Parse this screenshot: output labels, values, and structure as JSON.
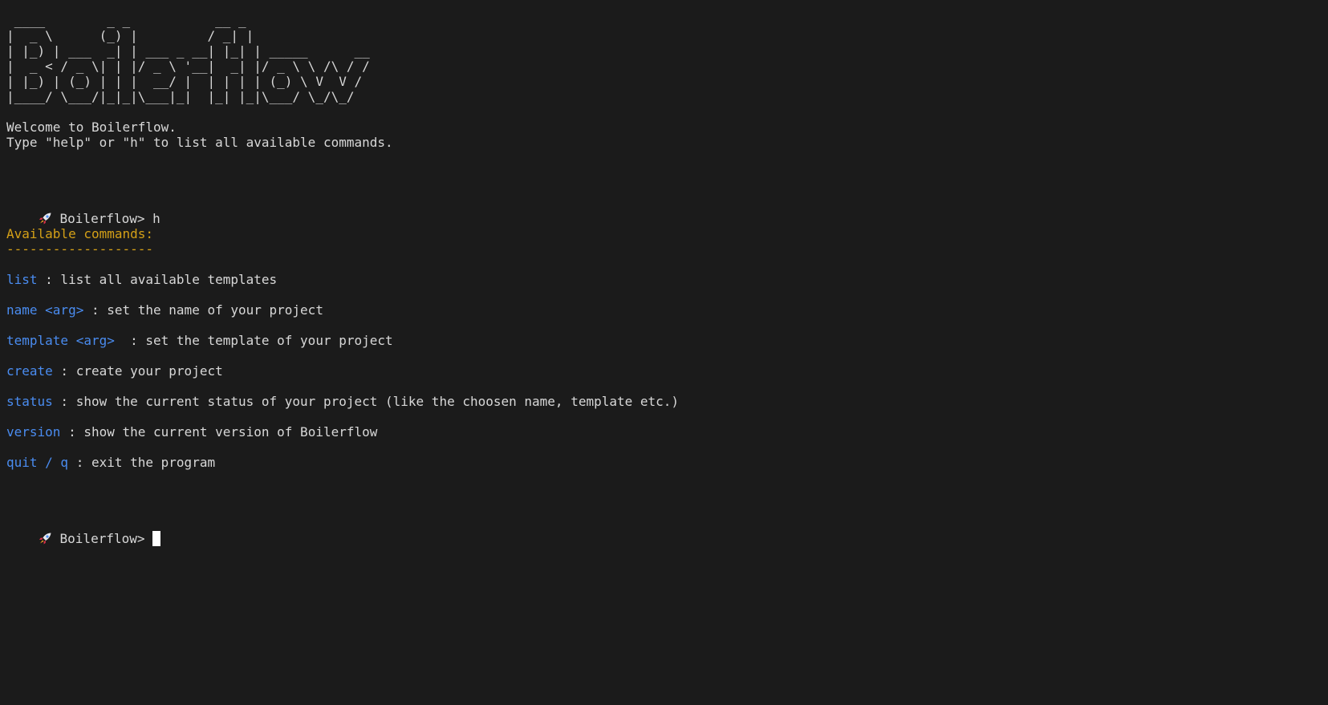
{
  "banner": {
    "ascii_art": " ____        _ _           __ _\n|  _ \\      (_) |         / _| |\n| |_) | ___  _| | ___ _ __| |_| | _____      __\n|  _ < / _ \\| | |/ _ \\ '__|  _| |/ _ \\ \\ /\\ / /\n| |_) | (_) | | |  __/ |  | | | | (_) \\ V  V /\n|____/ \\___/|_|_|\\___|_|  |_| |_|\\___/ \\_/\\_/",
    "welcome": "Welcome to Boilerflow.",
    "hint": "Type \"help\" or \"h\" to list all available commands."
  },
  "prompt": {
    "icon": "rocket-icon",
    "label": "Boilerflow>",
    "first_input": "h"
  },
  "help": {
    "heading": "Available commands:",
    "underline": "-------------------",
    "commands": [
      {
        "name": "list",
        "description": " : list all available templates"
      },
      {
        "name": "name <arg>",
        "description": " : set the name of your project"
      },
      {
        "name": "template <arg>",
        "description": "  : set the template of your project"
      },
      {
        "name": "create",
        "description": " : create your project"
      },
      {
        "name": "status",
        "description": " : show the current status of your project (like the choosen name, template etc.)"
      },
      {
        "name": "version",
        "description": " : show the current version of Boilerflow"
      },
      {
        "name": "quit / q",
        "description": " : exit the program"
      }
    ]
  },
  "colors": {
    "background": "#1b1b1b",
    "text": "#d8d8d8",
    "heading": "#d4a017",
    "command": "#4a8cf0"
  }
}
